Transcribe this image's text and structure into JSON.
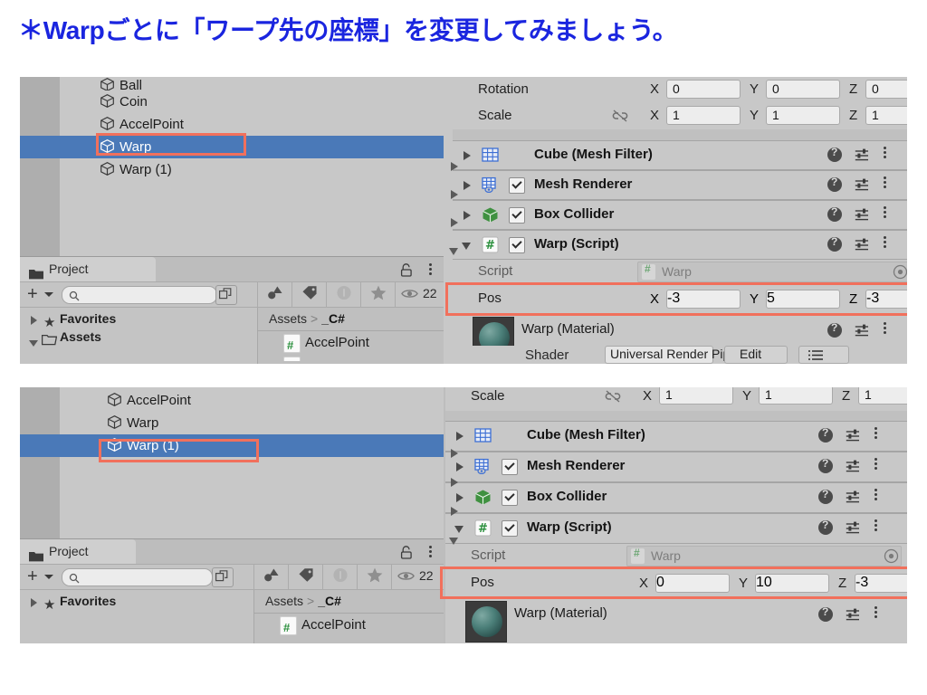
{
  "title": "＊Warpごとに「ワープ先の座標」を変更してみましょう。",
  "colors": {
    "title": "#1a25df",
    "selection_blue": "#4a79b8",
    "highlight_red": "#f1705c",
    "panel_gray": "#c8c8c8"
  },
  "panels": [
    {
      "id": "top",
      "hierarchy": {
        "items": [
          {
            "label": "Ball",
            "selected": false,
            "clipped": true
          },
          {
            "label": "Coin",
            "selected": false
          },
          {
            "label": "AccelPoint",
            "selected": false
          },
          {
            "label": "Warp",
            "selected": true,
            "highlighted": true
          },
          {
            "label": "Warp (1)",
            "selected": false
          }
        ]
      },
      "project": {
        "tab_label": "Project",
        "search_value": "",
        "visible_count": "22",
        "favorites_label": "Favorites",
        "assets_label": "Assets",
        "breadcrumb": {
          "root": "Assets",
          "current": "_C#"
        },
        "files": [
          {
            "name": "AccelPoint"
          }
        ]
      },
      "inspector": {
        "transform": [
          {
            "label": "Rotation",
            "x": "0",
            "y": "0",
            "z": "0",
            "link": false
          },
          {
            "label": "Scale",
            "x": "1",
            "y": "1",
            "z": "1",
            "link": true
          }
        ],
        "components": [
          {
            "name": "Cube (Mesh Filter)",
            "icon": "mesh-filter-icon",
            "has_checkbox": false,
            "expanded": false
          },
          {
            "name": "Mesh Renderer",
            "icon": "mesh-renderer-icon",
            "has_checkbox": true,
            "checked": true,
            "expanded": false
          },
          {
            "name": "Box Collider",
            "icon": "box-collider-icon",
            "has_checkbox": true,
            "checked": true,
            "expanded": false
          },
          {
            "name": "Warp (Script)",
            "icon": "csharp-script-icon",
            "has_checkbox": true,
            "checked": true,
            "expanded": true
          }
        ],
        "script_row": {
          "label": "Script",
          "value": "Warp"
        },
        "pos_row": {
          "label": "Pos",
          "x": "-3",
          "y": "5",
          "z": "-3",
          "highlighted": true
        },
        "material": {
          "name": "Warp (Material)",
          "shader_label": "Shader",
          "shader_value": "Universal Render Pipel",
          "edit_label": "Edit"
        }
      }
    },
    {
      "id": "bottom",
      "hierarchy": {
        "items": [
          {
            "label": "AccelPoint",
            "selected": false
          },
          {
            "label": "Warp",
            "selected": false
          },
          {
            "label": "Warp (1)",
            "selected": true,
            "highlighted": true
          }
        ]
      },
      "project": {
        "tab_label": "Project",
        "search_value": "",
        "visible_count": "22",
        "favorites_label": "Favorites",
        "breadcrumb": {
          "root": "Assets",
          "current": "_C#"
        },
        "files": [
          {
            "name": "AccelPoint"
          }
        ]
      },
      "inspector": {
        "transform": [
          {
            "label": "Scale",
            "x": "1",
            "y": "1",
            "z": "1",
            "link": true
          }
        ],
        "components": [
          {
            "name": "Cube (Mesh Filter)",
            "icon": "mesh-filter-icon",
            "has_checkbox": false,
            "expanded": false
          },
          {
            "name": "Mesh Renderer",
            "icon": "mesh-renderer-icon",
            "has_checkbox": true,
            "checked": true,
            "expanded": false
          },
          {
            "name": "Box Collider",
            "icon": "box-collider-icon",
            "has_checkbox": true,
            "checked": true,
            "expanded": false
          },
          {
            "name": "Warp (Script)",
            "icon": "csharp-script-icon",
            "has_checkbox": true,
            "checked": true,
            "expanded": true
          }
        ],
        "script_row": {
          "label": "Script",
          "value": "Warp"
        },
        "pos_row": {
          "label": "Pos",
          "x": "0",
          "y": "10",
          "z": "-3",
          "highlighted": true
        },
        "material": {
          "name": "Warp (Material)"
        }
      }
    }
  ],
  "axes": {
    "x": "X",
    "y": "Y",
    "z": "Z"
  }
}
